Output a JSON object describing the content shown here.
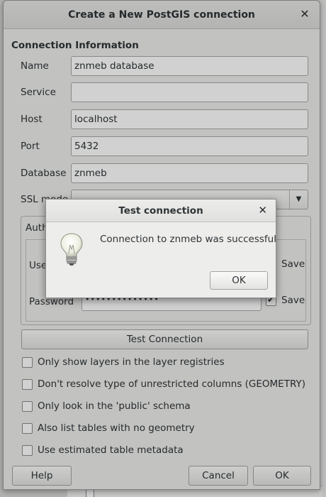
{
  "dialog": {
    "title": "Create a New PostGIS connection",
    "section_title": "Connection Information",
    "fields": [
      {
        "label": "Name",
        "value": "znmeb database"
      },
      {
        "label": "Service",
        "value": ""
      },
      {
        "label": "Host",
        "value": "localhost"
      },
      {
        "label": "Port",
        "value": "5432"
      },
      {
        "label": "Database",
        "value": "znmeb"
      }
    ],
    "ssl_label": "SSL mode",
    "auth": {
      "tab_label": "Authentication",
      "user_label": "Username",
      "password_label": "Password",
      "password_mask": "••••••••••••••",
      "save_label": "Save",
      "save_user_checked": false,
      "save_pass_checked": true
    },
    "test_button": "Test Connection",
    "options": [
      "Only show layers in the layer registries",
      "Don't resolve type of unrestricted columns (GEOMETRY)",
      "Only look in the 'public' schema",
      "Also list tables with no geometry",
      "Use estimated table metadata"
    ],
    "buttons": {
      "help": "Help",
      "cancel": "Cancel",
      "ok": "OK"
    }
  },
  "modal": {
    "title": "Test connection",
    "message": "Connection to znmeb was successful",
    "ok": "OK"
  },
  "icons": {
    "close": "close-icon",
    "lightbulb": "lightbulb-icon",
    "dropdown": "chevron-down-icon"
  }
}
